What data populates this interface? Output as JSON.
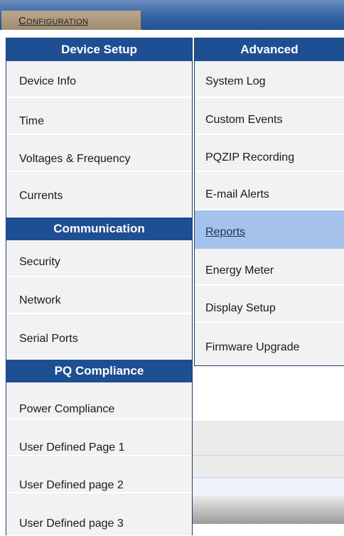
{
  "topbar": {
    "config_label": "Configuration"
  },
  "menu_left": {
    "sections": [
      {
        "title": "Device Setup",
        "items": [
          "Device Info",
          "Time",
          "Voltages & Frequency",
          "Currents"
        ]
      },
      {
        "title": "Communication",
        "items": [
          "Security",
          "Network",
          "Serial Ports"
        ]
      },
      {
        "title": "PQ Compliance",
        "items": [
          "Power Compliance",
          "User Defined Page 1",
          "User Defined page 2",
          "User Defined page 3"
        ]
      }
    ]
  },
  "menu_right": {
    "title": "Advanced",
    "items": [
      "System Log",
      "Custom Events",
      "PQZIP Recording",
      "E-mail Alerts",
      "Reports",
      "Energy Meter",
      "Display Setup",
      "Firmware Upgrade"
    ],
    "active_item": "Reports"
  },
  "colors": {
    "header_blue": "#1f4f93",
    "menu_bg": "#f2f2f2",
    "active_highlight": "#a4c2ec",
    "config_tab": "#a08c6e"
  }
}
